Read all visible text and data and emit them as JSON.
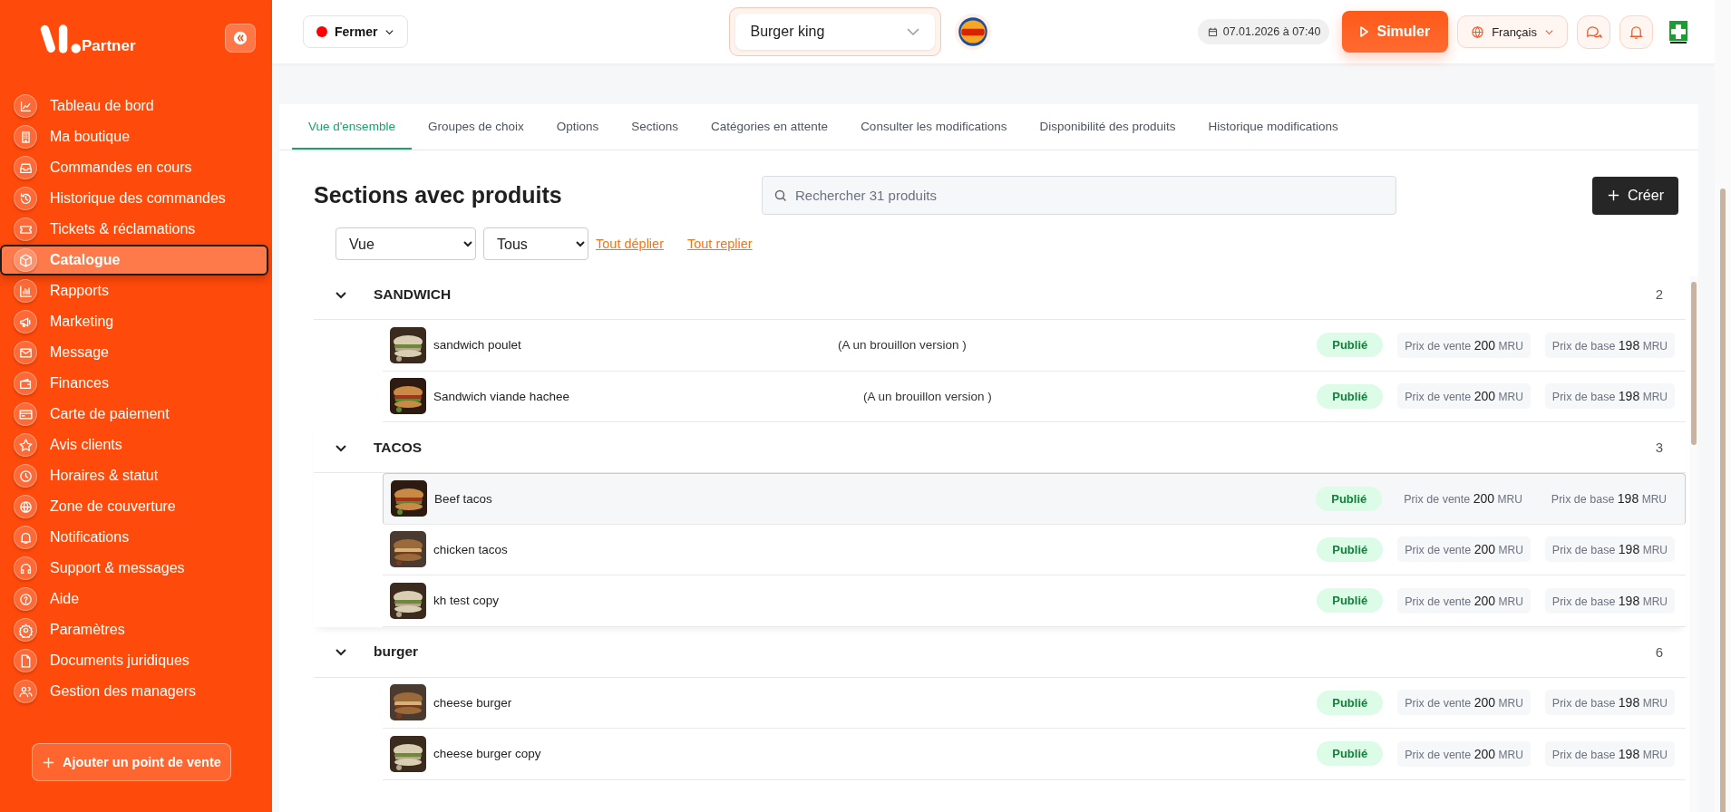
{
  "sidebar": {
    "brand": "Partner",
    "items": [
      {
        "label": "Tableau de bord",
        "selected": false
      },
      {
        "label": "Ma boutique",
        "selected": false
      },
      {
        "label": "Commandes en cours",
        "selected": false
      },
      {
        "label": "Historique des commandes",
        "selected": false
      },
      {
        "label": "Tickets & réclamations",
        "selected": false
      },
      {
        "label": "Catalogue",
        "selected": true
      },
      {
        "label": "Rapports",
        "selected": false
      },
      {
        "label": "Marketing",
        "selected": false
      },
      {
        "label": "Message",
        "selected": false
      },
      {
        "label": "Finances",
        "selected": false
      },
      {
        "label": "Carte de paiement",
        "selected": false
      },
      {
        "label": "Avis clients",
        "selected": false
      },
      {
        "label": "Horaires & statut",
        "selected": false
      },
      {
        "label": "Zone de couverture",
        "selected": false
      },
      {
        "label": "Notifications",
        "selected": false
      },
      {
        "label": "Support & messages",
        "selected": false
      },
      {
        "label": "Aide",
        "selected": false
      },
      {
        "label": "Paramètres",
        "selected": false
      },
      {
        "label": "Documents juridiques",
        "selected": false
      },
      {
        "label": "Gestion des managers",
        "selected": false
      }
    ],
    "add_button": "Ajouter un point de vente"
  },
  "topbar": {
    "status": {
      "label": "Fermer",
      "open": false
    },
    "store": "Burger king",
    "datetime": "07.01.2026 à 07:40",
    "simulate": "Simuler",
    "language": "Français"
  },
  "tabs": [
    {
      "label": "Vue d'ensemble",
      "selected": true
    },
    {
      "label": "Groupes de choix",
      "selected": false
    },
    {
      "label": "Options",
      "selected": false
    },
    {
      "label": "Sections",
      "selected": false
    },
    {
      "label": "Catégories en attente",
      "selected": false
    },
    {
      "label": "Consulter les modifications",
      "selected": false
    },
    {
      "label": "Disponibilité des produits",
      "selected": false
    },
    {
      "label": "Historique modifications",
      "selected": false
    }
  ],
  "page": {
    "title": "Sections avec produits",
    "search_placeholder": "Rechercher 31 produits",
    "create": "Créer",
    "view_select": "Vue",
    "filter_select": "Tous",
    "expand_all": "Tout déplier",
    "collapse_all": "Tout replier"
  },
  "sections": [
    {
      "name": "SANDWICH",
      "count": "2",
      "expanded": true,
      "products": [
        {
          "name": "sandwich poulet",
          "note": "(A un brouillon version )",
          "status": "Publié",
          "sale_label": "Prix de vente",
          "sale_price": "200",
          "sale_currency": "MRU",
          "base_label": "Prix de base",
          "base_price": "198",
          "base_currency": "MRU",
          "selected": false
        },
        {
          "name": "Sandwich viande hachee",
          "note": "(A un brouillon version )",
          "status": "Publié",
          "sale_label": "Prix de vente",
          "sale_price": "200",
          "sale_currency": "MRU",
          "base_label": "Prix de base",
          "base_price": "198",
          "base_currency": "MRU",
          "selected": false
        }
      ]
    },
    {
      "name": "TACOS",
      "count": "3",
      "expanded": true,
      "products": [
        {
          "name": "Beef tacos",
          "status": "Publié",
          "sale_label": "Prix de vente",
          "sale_price": "200",
          "sale_currency": "MRU",
          "base_label": "Prix de base",
          "base_price": "198",
          "base_currency": "MRU",
          "selected": true
        },
        {
          "name": "chicken tacos",
          "status": "Publié",
          "sale_label": "Prix de vente",
          "sale_price": "200",
          "sale_currency": "MRU",
          "base_label": "Prix de base",
          "base_price": "198",
          "base_currency": "MRU",
          "selected": false
        },
        {
          "name": "kh test copy",
          "status": "Publié",
          "sale_label": "Prix de vente",
          "sale_price": "200",
          "sale_currency": "MRU",
          "base_label": "Prix de base",
          "base_price": "198",
          "base_currency": "MRU",
          "selected": false
        }
      ]
    },
    {
      "name": "burger",
      "count": "6",
      "expanded": true,
      "products": [
        {
          "name": "cheese burger",
          "status": "Publié",
          "sale_label": "Prix de vente",
          "sale_price": "200",
          "sale_currency": "MRU",
          "base_label": "Prix de base",
          "base_price": "198",
          "base_currency": "MRU",
          "selected": false
        },
        {
          "name": "cheese burger copy",
          "status": "Publié",
          "sale_label": "Prix de vente",
          "sale_price": "200",
          "sale_currency": "MRU",
          "base_label": "Prix de base",
          "base_price": "198",
          "base_currency": "MRU",
          "selected": false
        }
      ]
    }
  ]
}
